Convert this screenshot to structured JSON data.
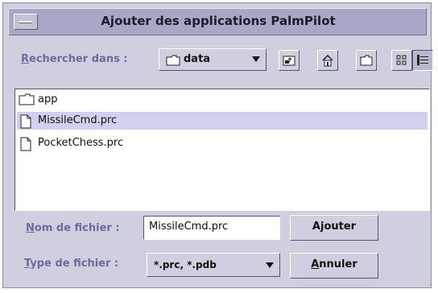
{
  "window": {
    "title": "Ajouter des applications PalmPilot"
  },
  "toolbar": {
    "look_in_label_first": "R",
    "look_in_label_rest": "echercher dans :",
    "look_in_value": "data",
    "icons": [
      "up-one-level-icon",
      "home-icon",
      "new-folder-icon",
      "list-view-icon",
      "details-view-icon"
    ]
  },
  "files": [
    {
      "name": "app",
      "type": "folder",
      "selected": false
    },
    {
      "name": "MissileCmd.prc",
      "type": "file",
      "selected": true
    },
    {
      "name": "PocketChess.prc",
      "type": "file",
      "selected": false
    }
  ],
  "form": {
    "filename_label_first": "N",
    "filename_label_rest": "om de fichier :",
    "filename_value": "MissileCmd.prc",
    "filetype_label_first": "T",
    "filetype_label_rest": "ype de fichier :",
    "filetype_value": "*.prc, *.pdb",
    "add_button": "Ajouter",
    "cancel_button_first": "A",
    "cancel_button_rest": "nnuler"
  },
  "colors": {
    "titlebar": "#a7a7c6",
    "background": "#cfcfe0",
    "selection": "#d0d0f0",
    "label": "#6b6ba0"
  }
}
